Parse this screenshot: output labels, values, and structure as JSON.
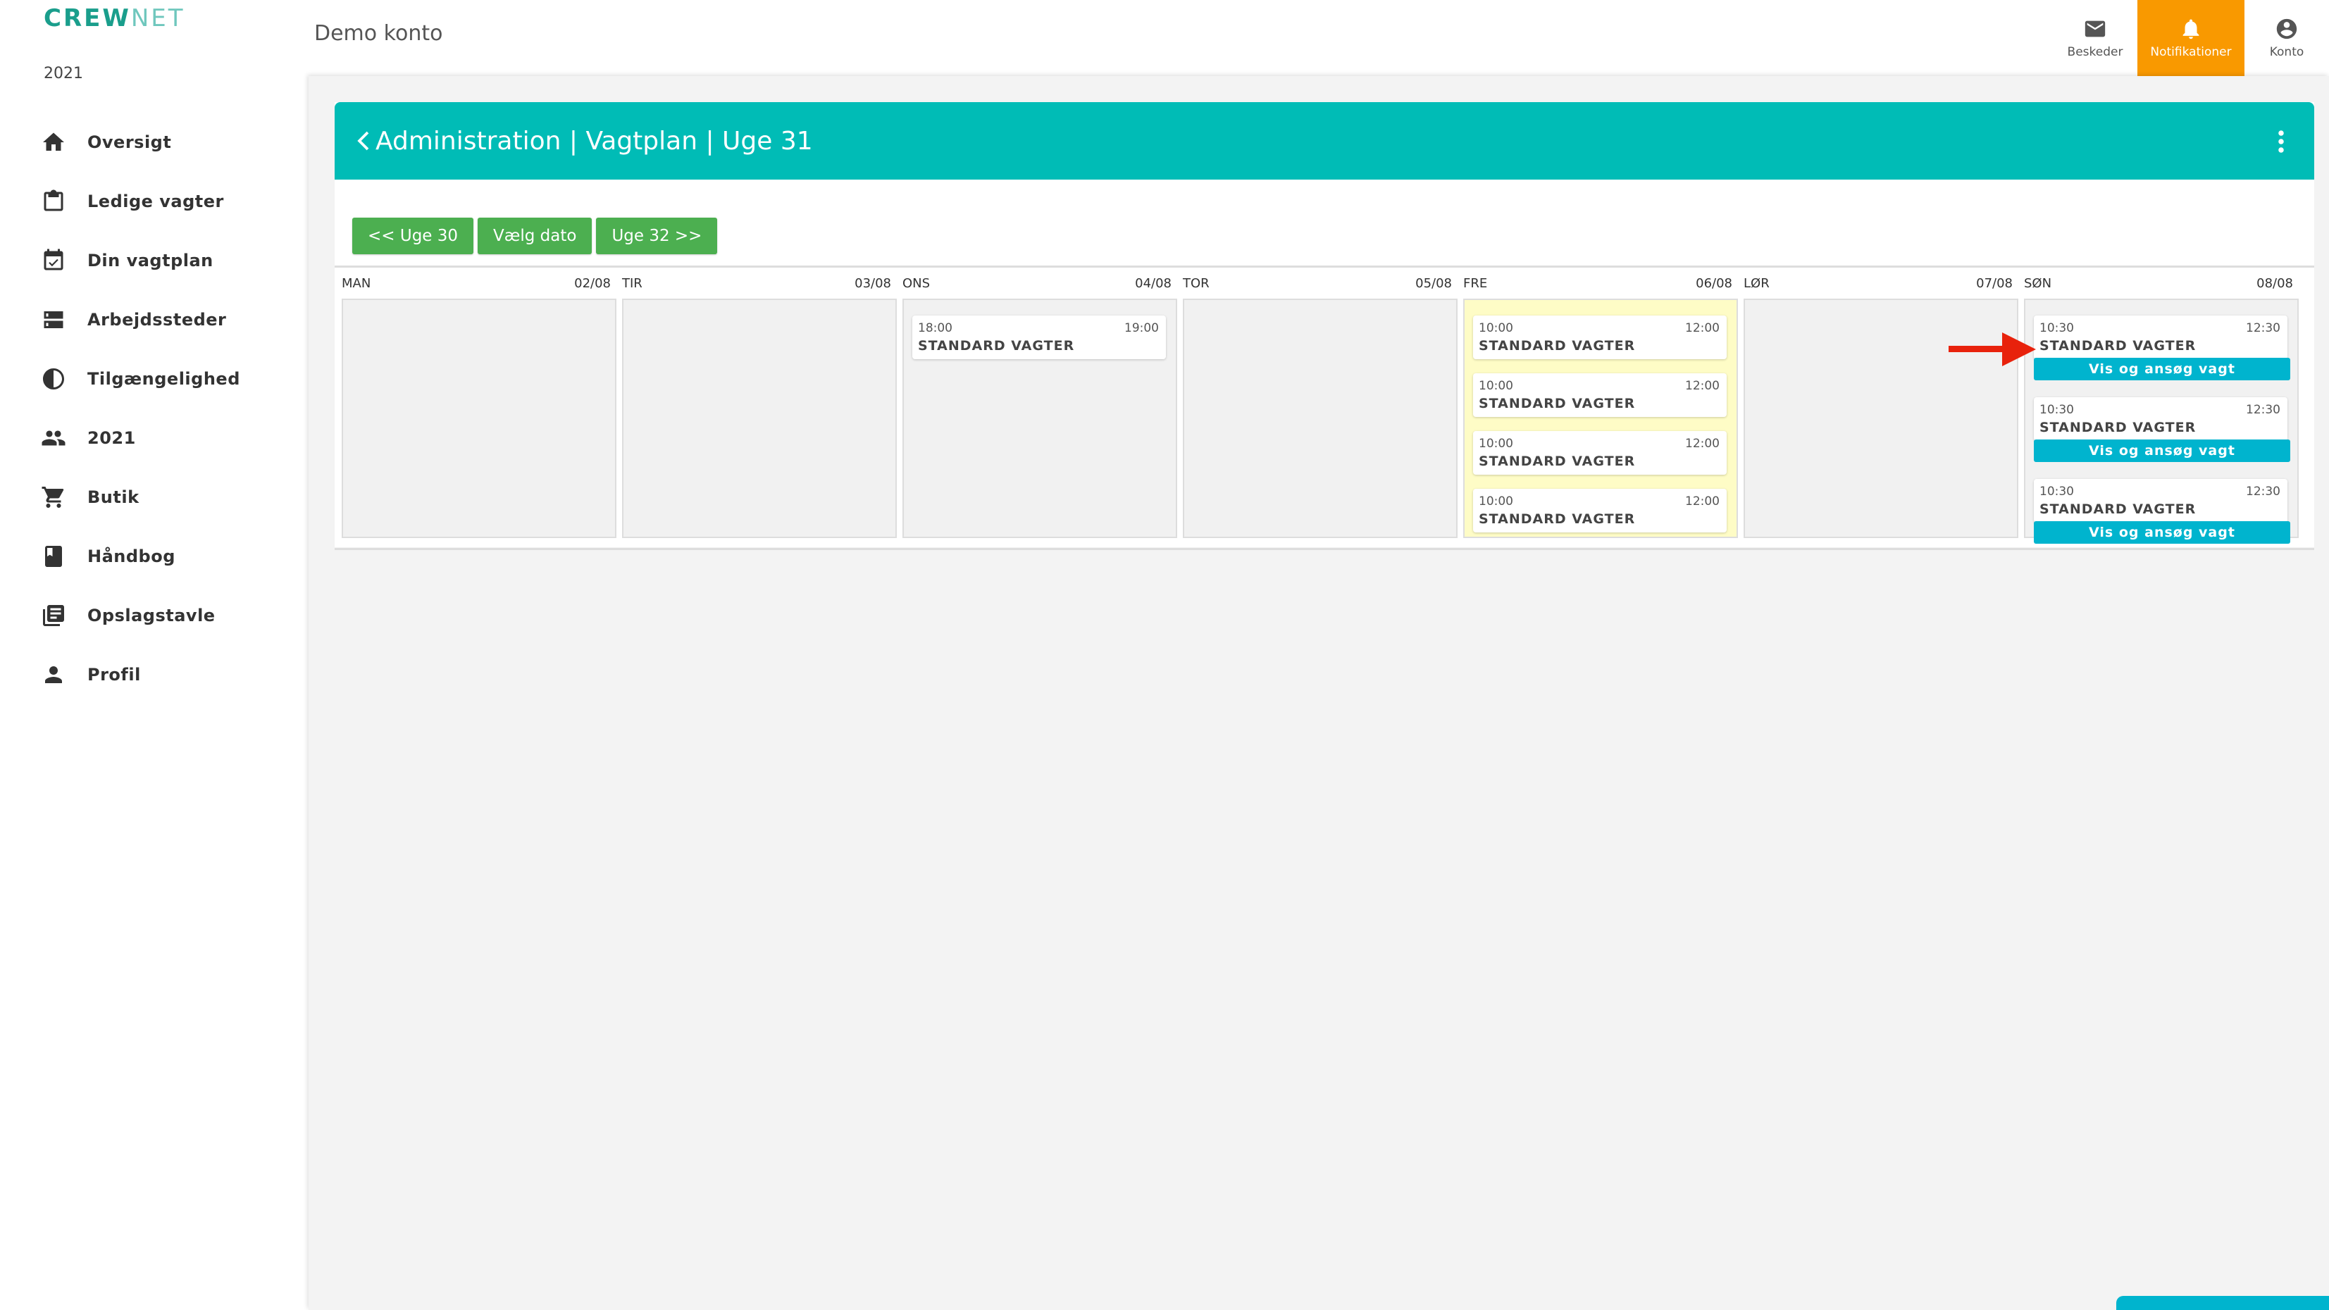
{
  "app": {
    "logo_part1": "CREW",
    "logo_part2": "NET",
    "year": "2021"
  },
  "sidebar": {
    "items": [
      {
        "label": "Oversigt",
        "icon": "home-icon"
      },
      {
        "label": "Ledige vagter",
        "icon": "clipboard-icon"
      },
      {
        "label": "Din vagtplan",
        "icon": "calendar-check-icon"
      },
      {
        "label": "Arbejdssteder",
        "icon": "server-icon"
      },
      {
        "label": "Tilgængelighed",
        "icon": "contrast-icon"
      },
      {
        "label": "2021",
        "icon": "people-icon"
      },
      {
        "label": "Butik",
        "icon": "cart-icon"
      },
      {
        "label": "Håndbog",
        "icon": "book-icon"
      },
      {
        "label": "Opslagstavle",
        "icon": "library-icon"
      },
      {
        "label": "Profil",
        "icon": "person-icon"
      }
    ]
  },
  "header": {
    "title": "Demo konto",
    "nav": [
      {
        "label": "Beskeder",
        "icon": "mail-icon",
        "active": false
      },
      {
        "label": "Notifikationer",
        "icon": "bell-icon",
        "active": true
      },
      {
        "label": "Konto",
        "icon": "account-icon",
        "active": false
      }
    ]
  },
  "schedule": {
    "title": "Administration | Vagtplan | Uge 31",
    "buttons": {
      "prev": "<< Uge 30",
      "pick": "Vælg dato",
      "next": "Uge 32 >>"
    },
    "days": [
      {
        "name": "MAN",
        "date": "02/08",
        "highlight": false,
        "shifts": []
      },
      {
        "name": "TIR",
        "date": "03/08",
        "highlight": false,
        "shifts": []
      },
      {
        "name": "ONS",
        "date": "04/08",
        "highlight": false,
        "shifts": [
          {
            "start": "18:00",
            "end": "19:00",
            "name": "STANDARD VAGTER",
            "action": ""
          }
        ]
      },
      {
        "name": "TOR",
        "date": "05/08",
        "highlight": false,
        "shifts": []
      },
      {
        "name": "FRE",
        "date": "06/08",
        "highlight": true,
        "shifts": [
          {
            "start": "10:00",
            "end": "12:00",
            "name": "STANDARD VAGTER",
            "action": ""
          },
          {
            "start": "10:00",
            "end": "12:00",
            "name": "STANDARD VAGTER",
            "action": ""
          },
          {
            "start": "10:00",
            "end": "12:00",
            "name": "STANDARD VAGTER",
            "action": ""
          },
          {
            "start": "10:00",
            "end": "12:00",
            "name": "STANDARD VAGTER",
            "action": ""
          }
        ]
      },
      {
        "name": "LØR",
        "date": "07/08",
        "highlight": false,
        "shifts": []
      },
      {
        "name": "SØN",
        "date": "08/08",
        "highlight": false,
        "shifts": [
          {
            "start": "10:30",
            "end": "12:30",
            "name": "STANDARD VAGTER",
            "action": "Vis og ansøg vagt"
          },
          {
            "start": "10:30",
            "end": "12:30",
            "name": "STANDARD VAGTER",
            "action": "Vis og ansøg vagt"
          },
          {
            "start": "10:30",
            "end": "12:30",
            "name": "STANDARD VAGTER",
            "action": "Vis og ansøg vagt"
          }
        ]
      }
    ]
  },
  "colors": {
    "teal": "#00bcb6",
    "green": "#4caf50",
    "orange": "#f99900",
    "cyan": "#00b4ce",
    "highlight": "#fefcc6",
    "arrow": "#e8220c"
  }
}
